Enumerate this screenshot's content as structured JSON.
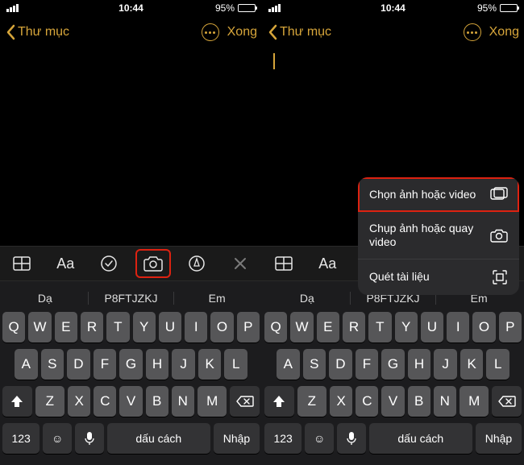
{
  "status": {
    "time": "10:44",
    "battery_pct": "95%"
  },
  "nav": {
    "back_label": "Thư mục",
    "done_label": "Xong"
  },
  "menu": {
    "choose": "Chọn ảnh hoặc video",
    "capture": "Chụp ảnh hoặc quay video",
    "scan": "Quét tài liệu"
  },
  "toolbar": {
    "aa": "Aa"
  },
  "suggestions": {
    "s1": "Dạ",
    "s2": "P8FTJZKJ",
    "s3": "Em"
  },
  "keys": {
    "row1": [
      "Q",
      "W",
      "E",
      "R",
      "T",
      "Y",
      "U",
      "I",
      "O",
      "P"
    ],
    "row2": [
      "A",
      "S",
      "D",
      "F",
      "G",
      "H",
      "J",
      "K",
      "L"
    ],
    "row3": [
      "Z",
      "X",
      "C",
      "V",
      "B",
      "N",
      "M"
    ],
    "num": "123",
    "space": "dấu cách",
    "return": "Nhập"
  }
}
